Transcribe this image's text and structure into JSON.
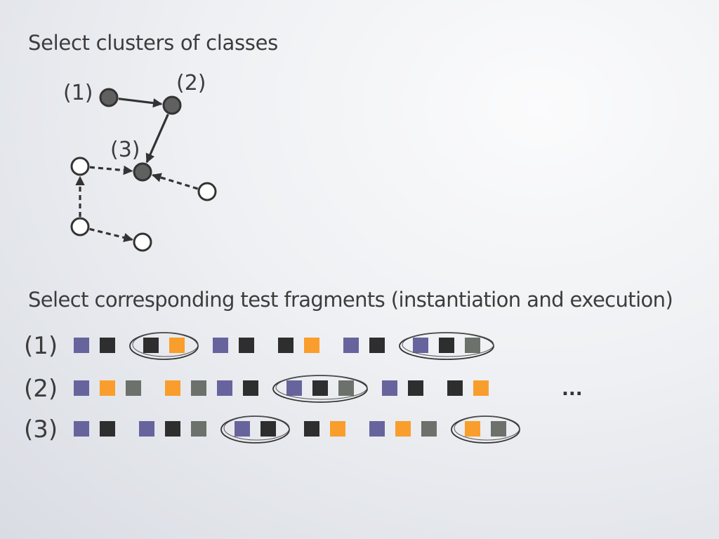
{
  "slide": {
    "heading_clusters": "Select clusters of classes",
    "heading_fragments": "Select corresponding test fragments (instantiation and execution)"
  },
  "graph": {
    "labeled_nodes": [
      {
        "id": "n1",
        "label": "(1)",
        "state": "selected"
      },
      {
        "id": "n2",
        "label": "(2)",
        "state": "selected"
      },
      {
        "id": "n3",
        "label": "(3)",
        "state": "selected"
      }
    ],
    "unlabeled_nodes": [
      {
        "id": "a",
        "state": "open"
      },
      {
        "id": "b",
        "state": "open"
      },
      {
        "id": "c",
        "state": "open"
      },
      {
        "id": "d",
        "state": "open"
      }
    ],
    "edges": [
      {
        "from": "n1",
        "to": "n2",
        "style": "solid"
      },
      {
        "from": "n2",
        "to": "n3",
        "style": "solid"
      },
      {
        "from": "a",
        "to": "n3",
        "style": "dashed"
      },
      {
        "from": "b",
        "to": "n3",
        "style": "dashed"
      },
      {
        "from": "c",
        "to": "a",
        "style": "dashed"
      },
      {
        "from": "c",
        "to": "d",
        "style": "dashed"
      }
    ]
  },
  "colors": {
    "purple": "#67639c",
    "dark": "#2e2e2e",
    "orange": "#f99d2c",
    "gray": "#6c716c",
    "node_fill_selected": "#606060",
    "stroke": "#333333"
  },
  "fragments": {
    "rows": [
      {
        "label": "(1)",
        "groups": [
          {
            "blocks": [
              "purple",
              "dark"
            ],
            "circled": false
          },
          {
            "blocks": [
              "dark",
              "orange"
            ],
            "circled": true
          },
          {
            "blocks": [
              "purple",
              "dark"
            ],
            "circled": false
          },
          {
            "blocks": [
              "dark",
              "orange"
            ],
            "circled": false
          },
          {
            "blocks": [
              "purple",
              "dark"
            ],
            "circled": false
          },
          {
            "blocks": [
              "purple",
              "dark",
              "gray"
            ],
            "circled": true
          }
        ]
      },
      {
        "label": "(2)",
        "groups": [
          {
            "blocks": [
              "purple",
              "orange",
              "gray"
            ],
            "circled": false
          },
          {
            "blocks": [
              "orange",
              "gray",
              "purple",
              "dark"
            ],
            "circled": false
          },
          {
            "blocks": [
              "purple",
              "dark",
              "gray"
            ],
            "circled": true
          },
          {
            "blocks": [
              "purple",
              "dark"
            ],
            "circled": false
          },
          {
            "blocks": [
              "dark",
              "orange"
            ],
            "circled": false
          }
        ],
        "trailing": "..."
      },
      {
        "label": "(3)",
        "groups": [
          {
            "blocks": [
              "purple",
              "dark"
            ],
            "circled": false
          },
          {
            "blocks": [
              "purple",
              "dark",
              "gray"
            ],
            "circled": false
          },
          {
            "blocks": [
              "purple",
              "dark"
            ],
            "circled": true
          },
          {
            "blocks": [
              "dark",
              "orange"
            ],
            "circled": false
          },
          {
            "blocks": [
              "purple",
              "orange",
              "gray"
            ],
            "circled": false
          },
          {
            "blocks": [
              "orange",
              "gray"
            ],
            "circled": true
          }
        ]
      }
    ]
  }
}
